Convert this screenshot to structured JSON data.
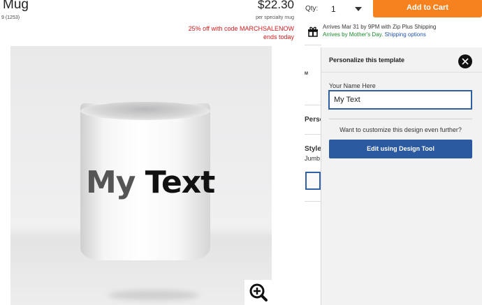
{
  "product": {
    "title": "Mug",
    "rating_text": "9 (1253)",
    "price": "$22.30",
    "price_unit": "per specialty mug",
    "promo_line1": "25% off with code MARCHSALENOW",
    "promo_line2": "ends today",
    "mug_text_part1": "My",
    "mug_text_part2": "Text"
  },
  "purchase": {
    "qty_label": "Qty:",
    "qty_value": "1",
    "add_to_cart": "Add to Cart",
    "ship_line": "Arrives Mar 31 by 9PM with Zip Plus Shipping",
    "ship_arrival": "Arrives by Mother's Day.",
    "ship_options": "Shipping options"
  },
  "background_column": {
    "item_a": "M",
    "item_b": "Perso",
    "item_c": "Style",
    "item_d": "Jumb"
  },
  "panel": {
    "title": "Personalize this template",
    "field_label": "Your Name Here",
    "field_value": "My Text",
    "customize_text": "Want to customize this design even further?",
    "edit_button": "Edit using Design Tool"
  },
  "colors": {
    "accent_orange": "#f5821f",
    "primary_blue": "#2b5aa0",
    "promo_red": "#d01c1c",
    "ship_green": "#1a8a2e"
  }
}
